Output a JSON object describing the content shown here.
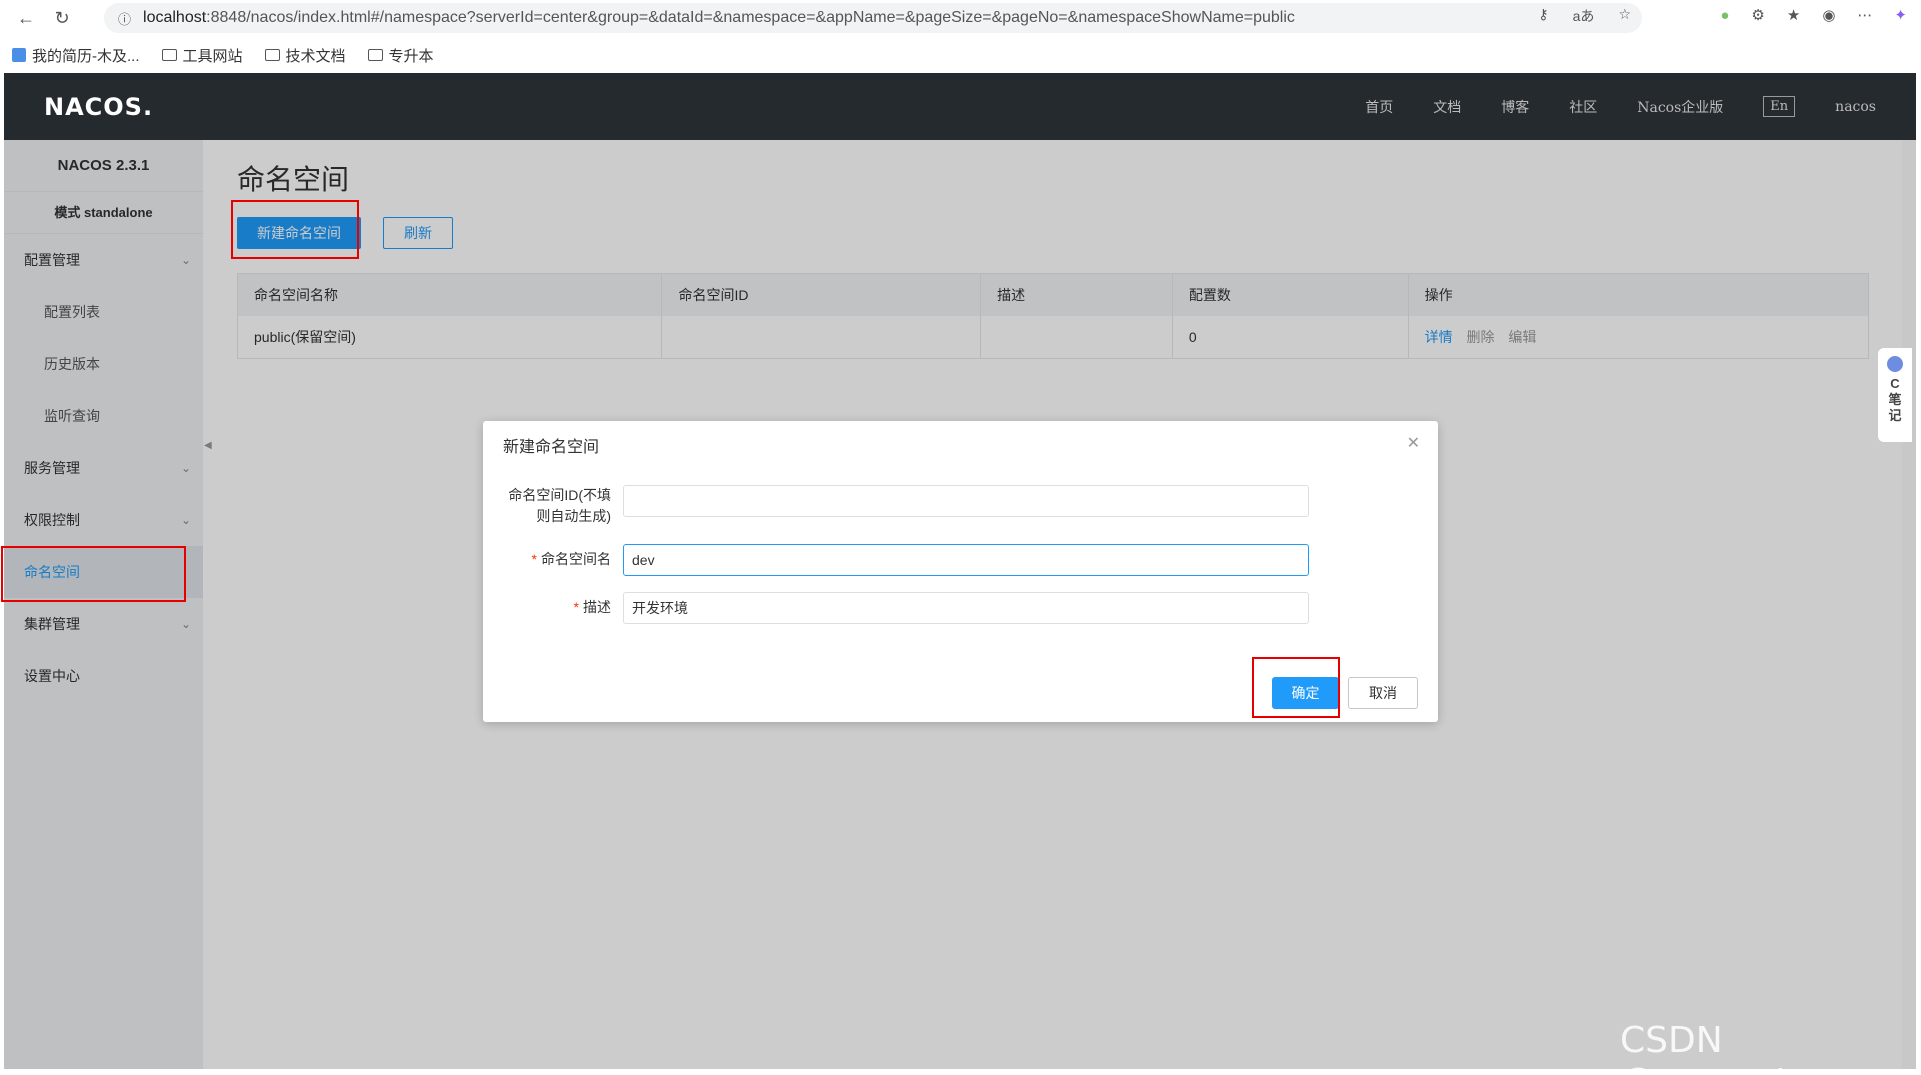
{
  "browser": {
    "url_host": "localhost",
    "url_rest": ":8848/nacos/index.html#/namespace?serverId=center&group=&dataId=&namespace=&appName=&pageSize=&pageNo=&namespaceShowName=public",
    "bookmarks": [
      "我的简历-木及...",
      "工具网站",
      "技术文档",
      "专升本"
    ]
  },
  "header": {
    "logo": "NACOS.",
    "nav": [
      "首页",
      "文档",
      "博客",
      "社区",
      "Nacos企业版"
    ],
    "lang": "En",
    "user": "nacos"
  },
  "sidebar": {
    "version": "NACOS 2.3.1",
    "mode": "模式 standalone",
    "items": [
      {
        "label": "配置管理",
        "type": "group"
      },
      {
        "label": "配置列表",
        "type": "sub"
      },
      {
        "label": "历史版本",
        "type": "sub"
      },
      {
        "label": "监听查询",
        "type": "sub"
      },
      {
        "label": "服务管理",
        "type": "group"
      },
      {
        "label": "权限控制",
        "type": "group"
      },
      {
        "label": "命名空间",
        "type": "active"
      },
      {
        "label": "集群管理",
        "type": "group"
      },
      {
        "label": "设置中心",
        "type": "item"
      }
    ]
  },
  "main": {
    "title": "命名空间",
    "new_button": "新建命名空间",
    "refresh_button": "刷新",
    "table": {
      "headers": [
        "命名空间名称",
        "命名空间ID",
        "描述",
        "配置数",
        "操作"
      ],
      "rows": [
        {
          "name": "public(保留空间)",
          "id": "",
          "desc": "",
          "count": "0",
          "ops": [
            "详情",
            "删除",
            "编辑"
          ]
        }
      ]
    }
  },
  "dialog": {
    "title": "新建命名空间",
    "id_label": "命名空间ID(不填则自动生成)",
    "id_label_line1": "命名空间ID(不填",
    "id_label_line2": "则自动生成)",
    "id_value": "",
    "name_label": "命名空间名",
    "name_value": "dev",
    "desc_label": "描述",
    "desc_value": "开发环境",
    "ok": "确定",
    "cancel": "取消"
  },
  "side_widget": {
    "label_c": "C",
    "label_1": "笔",
    "label_2": "记"
  },
  "watermark": "CSDN @azoon.top",
  "colors": {
    "primary": "#209bfa",
    "topbar": "#252a2f",
    "highlight": "#e60000"
  }
}
